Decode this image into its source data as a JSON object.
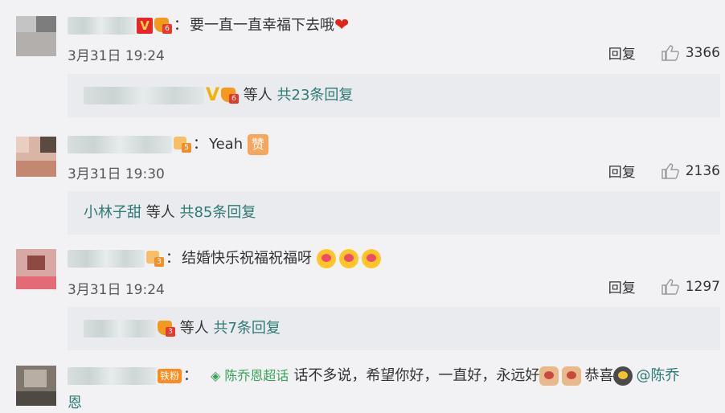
{
  "comments": [
    {
      "text": "要一直一直幸福下去哦",
      "time": "3月31日 19:24",
      "reply_label": "回复",
      "likes": "3366",
      "sub": {
        "suffix": "等人",
        "count_link": "共23条回复"
      }
    },
    {
      "text": "Yeah",
      "emoji_label": "赞",
      "time": "3月31日 19:30",
      "reply_label": "回复",
      "likes": "2136",
      "sub": {
        "name": "小林子甜",
        "suffix": "等人",
        "count_link": "共85条回复"
      }
    },
    {
      "text": "结婚快乐祝福祝福呀",
      "time": "3月31日 19:24",
      "reply_label": "回复",
      "likes": "1297",
      "sub": {
        "suffix": "等人",
        "count_link": "共7条回复"
      }
    },
    {
      "fan_badge": "铁粉",
      "supertopic": "陈乔恩超话",
      "text": "话不多说，希望你好，一直好，永远好",
      "text2": "恭喜",
      "mention": "@陈乔",
      "mention_cont": "恩"
    }
  ],
  "badges": {
    "level_1": "6",
    "level_2": "5",
    "level_3": "3"
  },
  "colors": {
    "link": "#2e7a74",
    "like_icon": "#999999",
    "heart": "#e2231a"
  }
}
